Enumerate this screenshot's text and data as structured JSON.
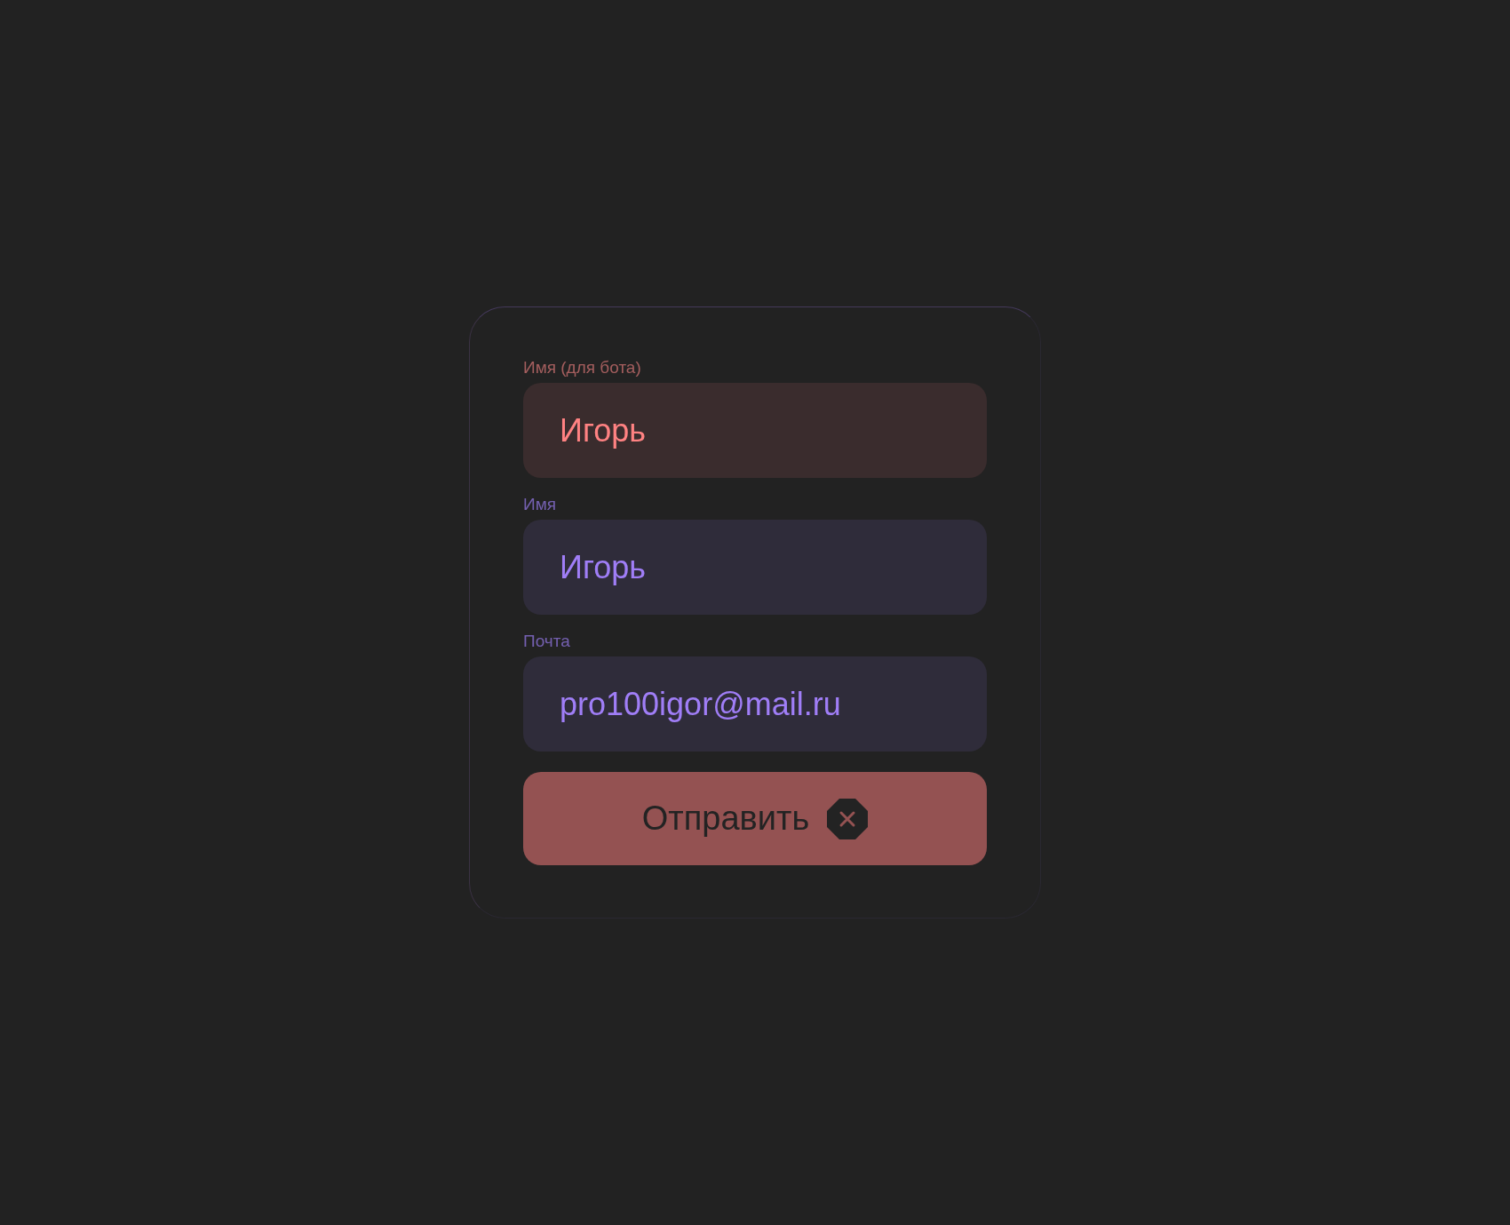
{
  "form": {
    "fields": [
      {
        "label": "Имя (для бота)",
        "value": "Игорь",
        "invalid": true
      },
      {
        "label": "Имя",
        "value": "Игорь",
        "invalid": false
      },
      {
        "label": "Почта",
        "value": "pro100igor@mail.ru",
        "invalid": false
      }
    ],
    "submit_button": {
      "label": "Отправить",
      "disabled": true
    }
  }
}
